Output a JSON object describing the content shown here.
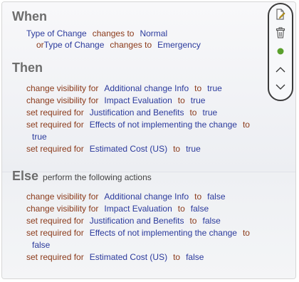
{
  "when": {
    "heading": "When",
    "conditions": [
      {
        "prefix": "",
        "field": "Type of Change",
        "op": "changes to",
        "value": "Normal"
      },
      {
        "prefix": "or",
        "field": "Type of Change",
        "op": "changes to",
        "value": "Emergency"
      }
    ]
  },
  "then": {
    "heading": "Then",
    "actions": [
      {
        "action": "change visibility for",
        "field": "Additional change Info",
        "to": "to",
        "value": "true"
      },
      {
        "action": "change visibility for",
        "field": "Impact Evaluation",
        "to": "to",
        "value": "true"
      },
      {
        "action": "set required for",
        "field": "Justification and Benefits",
        "to": "to",
        "value": "true"
      },
      {
        "action": "set required for",
        "field": "Effects of not implementing the change",
        "to": "to",
        "value": "true"
      },
      {
        "action": "set required for",
        "field": "Estimated Cost (US)",
        "to": "to",
        "value": "true"
      }
    ]
  },
  "else": {
    "heading": "Else",
    "subheading": "perform the following actions",
    "actions": [
      {
        "action": "change visibility for",
        "field": "Additional change Info",
        "to": "to",
        "value": "false"
      },
      {
        "action": "change visibility for",
        "field": "Impact Evaluation",
        "to": "to",
        "value": "false"
      },
      {
        "action": "set required for",
        "field": "Justification and Benefits",
        "to": "to",
        "value": "false"
      },
      {
        "action": "set required for",
        "field": "Effects of not implementing the change",
        "to": "to",
        "value": "false"
      },
      {
        "action": "set required for",
        "field": "Estimated Cost (US)",
        "to": "to",
        "value": "false"
      }
    ]
  },
  "toolbar": {
    "icons": [
      "edit-icon",
      "trash-icon",
      "status-dot-icon",
      "chevron-up-icon",
      "chevron-down-icon"
    ],
    "status_color": "#5aa02c"
  },
  "colors": {
    "keyword": "#8b3a1a",
    "value": "#2b3a9c",
    "heading": "#6d6d6d"
  }
}
